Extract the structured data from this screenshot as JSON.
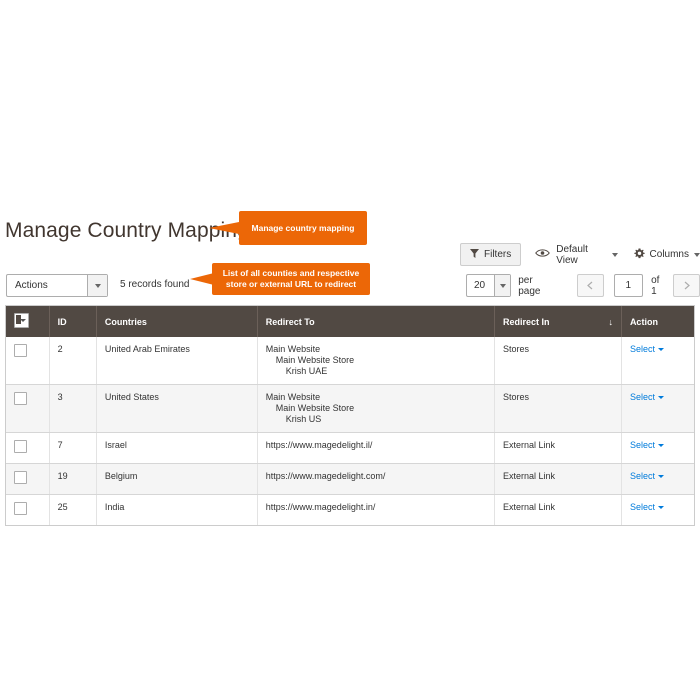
{
  "page_title": "Manage Country Mapping",
  "callouts": [
    {
      "text": "Manage country mapping"
    },
    {
      "text": "List of all counties and respective store or external URL to redirect"
    }
  ],
  "controls": {
    "filters_label": "Filters",
    "filters_icon": "funnel-icon",
    "view_label": "Default View",
    "view_icon": "eye-icon",
    "columns_label": "Columns",
    "columns_icon": "gear-icon"
  },
  "toolbar": {
    "actions_label": "Actions",
    "records_found": "5 records found",
    "per_page_value": "20",
    "per_page_label": "per page",
    "page_value": "1",
    "of_pages": "of 1",
    "prev_icon": "chevron-left-icon",
    "next_icon": "chevron-right-icon"
  },
  "grid": {
    "columns": [
      {
        "key": "check",
        "label": ""
      },
      {
        "key": "id",
        "label": "ID"
      },
      {
        "key": "countries",
        "label": "Countries"
      },
      {
        "key": "redirect_to",
        "label": "Redirect To"
      },
      {
        "key": "redirect_in",
        "label": "Redirect In",
        "sort": "↓"
      },
      {
        "key": "action",
        "label": "Action"
      }
    ],
    "action_label": "Select",
    "rows": [
      {
        "id": "2",
        "countries": "United Arab Emirates",
        "redirect_to": [
          "Main Website",
          "Main Website Store",
          "Krish UAE"
        ],
        "redirect_in": "Stores"
      },
      {
        "id": "3",
        "countries": "United States",
        "redirect_to": [
          "Main Website",
          "Main Website Store",
          "Krish US"
        ],
        "redirect_in": "Stores"
      },
      {
        "id": "7",
        "countries": "Israel",
        "redirect_to": [
          "https://www.magedelight.il/"
        ],
        "redirect_in": "External Link"
      },
      {
        "id": "19",
        "countries": "Belgium",
        "redirect_to": [
          "https://www.magedelight.com/"
        ],
        "redirect_in": "External Link"
      },
      {
        "id": "25",
        "countries": "India",
        "redirect_to": [
          "https://www.magedelight.in/"
        ],
        "redirect_in": "External Link"
      }
    ]
  },
  "colors": {
    "accent_orange": "#ec6707",
    "header_brown": "#514943",
    "link_blue": "#007bdb"
  }
}
